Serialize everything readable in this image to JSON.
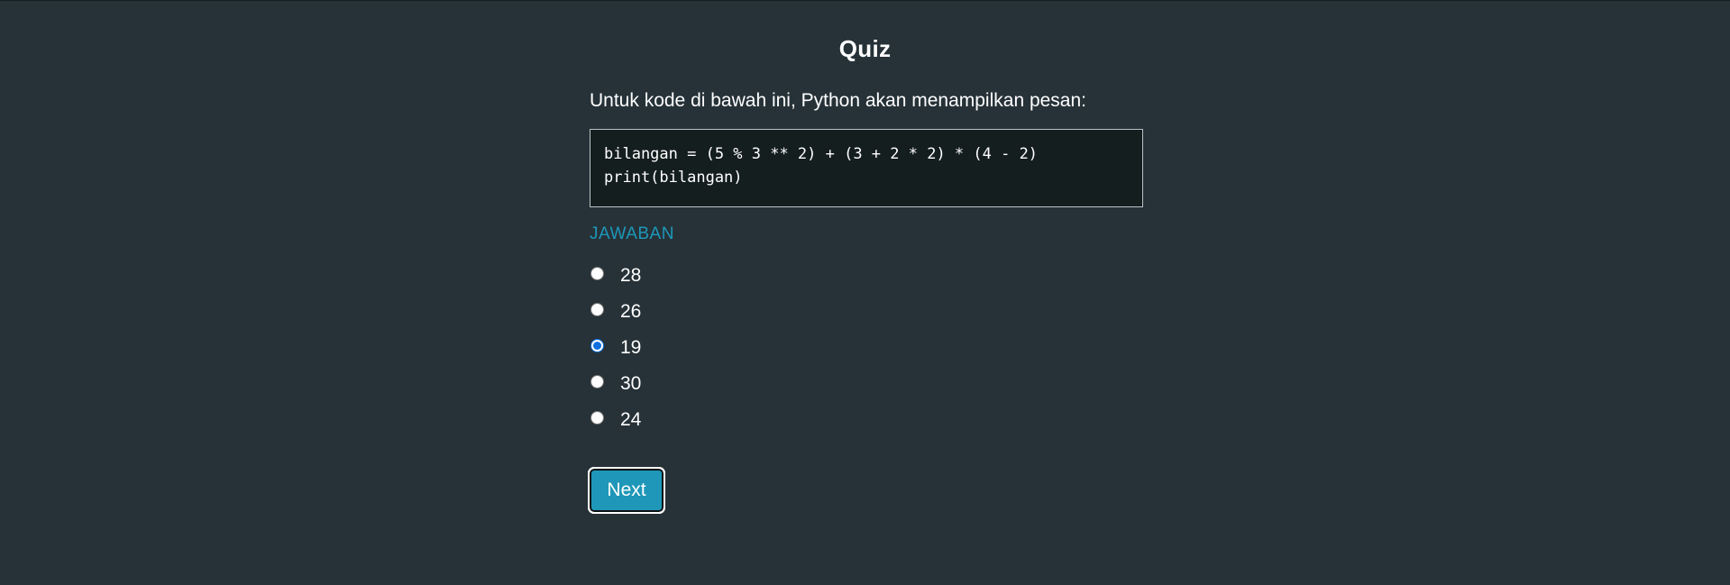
{
  "page": {
    "title": "Quiz"
  },
  "question": {
    "text": "Untuk kode di bawah ini, Python akan menampilkan pesan:",
    "code_lines": [
      "bilangan = (5 % 3 ** 2) + (3 + 2 * 2) * (4 - 2)",
      "print(bilangan)"
    ]
  },
  "answers": {
    "label": "JAWABAN",
    "options": [
      {
        "label": "28",
        "selected": false
      },
      {
        "label": "26",
        "selected": false
      },
      {
        "label": "19",
        "selected": true
      },
      {
        "label": "30",
        "selected": false
      },
      {
        "label": "24",
        "selected": false
      }
    ]
  },
  "actions": {
    "next_label": "Next"
  },
  "colors": {
    "background": "#263238",
    "code_background": "#151e1f",
    "accent": "#1f97b8",
    "radio_selected": "#0b6fe0"
  }
}
